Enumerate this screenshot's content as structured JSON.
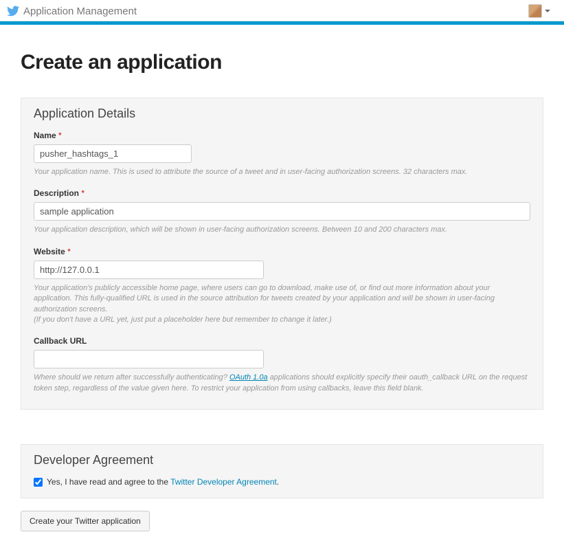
{
  "nav": {
    "title": "Application Management"
  },
  "page": {
    "heading": "Create an application"
  },
  "details": {
    "panel_title": "Application Details",
    "name": {
      "label": "Name",
      "value": "pusher_hashtags_1",
      "help": "Your application name. This is used to attribute the source of a tweet and in user-facing authorization screens. 32 characters max."
    },
    "description": {
      "label": "Description",
      "value": "sample application",
      "help": "Your application description, which will be shown in user-facing authorization screens. Between 10 and 200 characters max."
    },
    "website": {
      "label": "Website",
      "value": "http://127.0.0.1",
      "help1": "Your application's publicly accessible home page, where users can go to download, make use of, or find out more information about your application. This fully-qualified URL is used in the source attribution for tweets created by your application and will be shown in user-facing authorization screens.",
      "help2": "(If you don't have a URL yet, just put a placeholder here but remember to change it later.)"
    },
    "callback": {
      "label": "Callback URL",
      "value": "",
      "help_before": "Where should we return after successfully authenticating? ",
      "help_link": "OAuth 1.0a",
      "help_after": " applications should explicitly specify their oauth_callback URL on the request token step, regardless of the value given here. To restrict your application from using callbacks, leave this field blank."
    }
  },
  "agreement": {
    "panel_title": "Developer Agreement",
    "label_before": "Yes, I have read and agree to the ",
    "link_text": "Twitter Developer Agreement",
    "label_after": "."
  },
  "submit": {
    "label": "Create your Twitter application"
  }
}
